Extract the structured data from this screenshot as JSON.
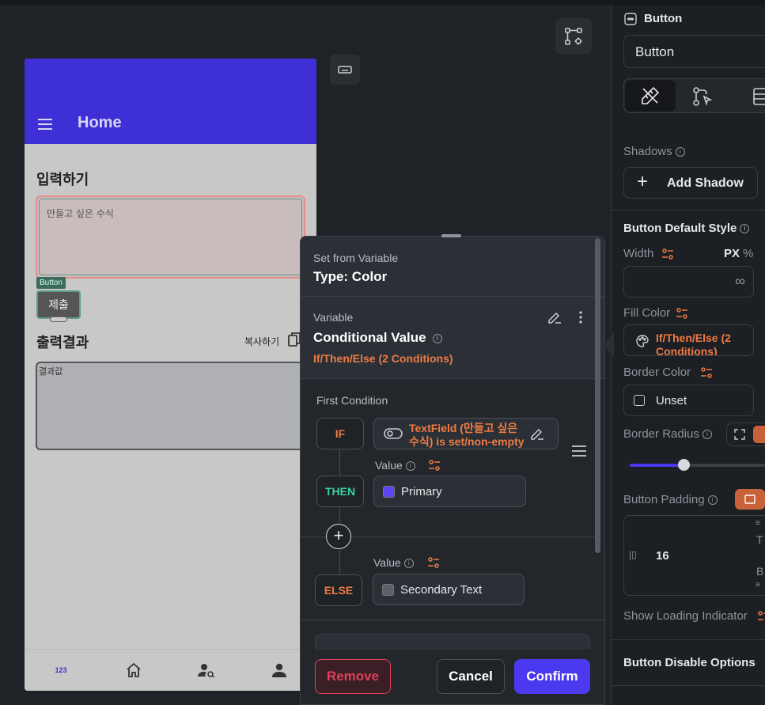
{
  "phone": {
    "appbar_title": "Home",
    "section1_label": "입력하기",
    "textfield_placeholder": "만들고 싶은 수식",
    "button_tag": "Button",
    "submit_label": "제출",
    "section2_label": "출력결과",
    "copy_label": "복사하기",
    "result_text": "결과값",
    "nav_items": [
      "123",
      "home",
      "person-search",
      "person"
    ]
  },
  "panel": {
    "widget_type": "Button",
    "widget_name": "Button",
    "shadows_label": "Shadows",
    "add_shadow_label": "Add Shadow",
    "default_style_heading": "Button Default Style",
    "width_label": "Width",
    "unit_px": "PX",
    "unit_pct": "%",
    "width_value": "∞",
    "fill_color_label": "Fill Color",
    "fill_color_value": "If/Then/Else (2 Conditions)",
    "border_color_label": "Border Color",
    "border_color_value": "Unset",
    "border_radius_label": "Border Radius",
    "button_padding_label": "Button Padding",
    "padding_value": "16",
    "padding_t": "T",
    "padding_b": "B",
    "loading_indicator_label": "Show Loading Indicator",
    "disable_options_heading": "Button Disable Options",
    "slider_fraction": 0.4
  },
  "modal": {
    "header_small": "Set from Variable",
    "header_big": "Type: Color",
    "variable_small": "Variable",
    "variable_big": "Conditional Value",
    "variable_sub": "If/Then/Else (2 Conditions)",
    "first_condition_label": "First Condition",
    "if_tag": "IF",
    "if_condition": "TextField (만들고 싶은 수식) is set/non-empty",
    "then_tag": "THEN",
    "value_label": "Value",
    "then_value": "Primary",
    "then_color": "#5b45f5",
    "else_tag": "ELSE",
    "else_value": "Secondary Text",
    "else_color": "#5c6168",
    "remove_label": "Remove",
    "cancel_label": "Cancel",
    "confirm_label": "Confirm"
  },
  "colors": {
    "accent": "#4b39ef",
    "orange": "#ef7b45",
    "then_green": "#39d2a0",
    "remove_red": "#e0405a"
  }
}
